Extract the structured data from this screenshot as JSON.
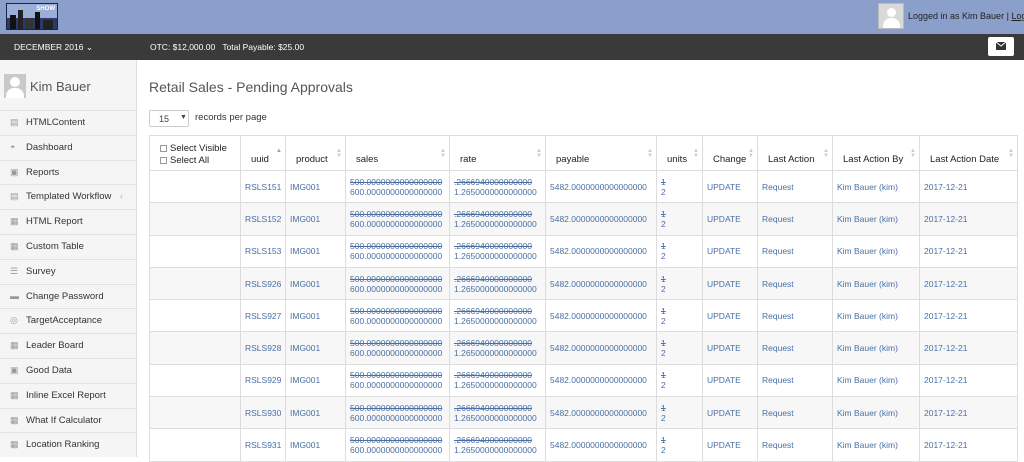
{
  "header": {
    "logo_text": "SHOW",
    "login_prefix": "Logged in as Kim Bauer",
    "separator": "|",
    "logout_label": "Logout"
  },
  "subbar": {
    "month_label": "DECEMBER 2016",
    "otc_label": "OTC: $12,000.00",
    "total_payable_label": "Total Payable: $25.00",
    "mail_icon": "envelope-icon"
  },
  "sidebar": {
    "user_name": "Kim Bauer",
    "items": [
      {
        "label": "HTMLContent",
        "icon": "file-icon"
      },
      {
        "label": "Dashboard",
        "icon": "dashboard-icon"
      },
      {
        "label": "Reports",
        "icon": "folder-icon"
      },
      {
        "label": "Templated Workflow",
        "icon": "file-icon",
        "chevron": "‹"
      },
      {
        "label": "HTML Report",
        "icon": "grid-icon"
      },
      {
        "label": "Custom Table",
        "icon": "grid-icon"
      },
      {
        "label": "Survey",
        "icon": "list-icon"
      },
      {
        "label": "Change Password",
        "icon": "lock-icon"
      },
      {
        "label": "TargetAcceptance",
        "icon": "target-icon"
      },
      {
        "label": "Leader Board",
        "icon": "grid-icon"
      },
      {
        "label": "Good Data",
        "icon": "folder-icon"
      },
      {
        "label": "Inline Excel Report",
        "icon": "grid-icon"
      },
      {
        "label": "What If Calculator",
        "icon": "grid-icon"
      },
      {
        "label": "Location Ranking",
        "icon": "grid-icon"
      }
    ]
  },
  "main": {
    "title": "Retail Sales - Pending Approvals",
    "page_size": "15",
    "records_per_page": "records per page",
    "select_visible": "Select Visible",
    "select_all": "Select All",
    "columns": [
      "uuid",
      "product",
      "sales",
      "rate",
      "payable",
      "units",
      "Change",
      "Last Action",
      "Last Action By",
      "Last Action Date"
    ],
    "rows": [
      {
        "uuid": "RSLS151",
        "product": "IMG001",
        "sales_old": "500.0000000000000000",
        "sales_new": "600.0000000000000000",
        "rate_old": ".2666940000000000",
        "rate_new": "1.2650000000000000",
        "payable": "5482.0000000000000000",
        "units_old": "1",
        "units_new": "2",
        "change": "UPDATE",
        "last_action": "Request",
        "last_action_by": "Kim Bauer (kim)",
        "last_action_date": "2017-12-21"
      },
      {
        "uuid": "RSLS152",
        "product": "IMG001",
        "sales_old": "500.0000000000000000",
        "sales_new": "600.0000000000000000",
        "rate_old": ".2666940000000000",
        "rate_new": "1.2650000000000000",
        "payable": "5482.0000000000000000",
        "units_old": "1",
        "units_new": "2",
        "change": "UPDATE",
        "last_action": "Request",
        "last_action_by": "Kim Bauer (kim)",
        "last_action_date": "2017-12-21"
      },
      {
        "uuid": "RSLS153",
        "product": "IMG001",
        "sales_old": "500.0000000000000000",
        "sales_new": "600.0000000000000000",
        "rate_old": ".2666940000000000",
        "rate_new": "1.2650000000000000",
        "payable": "5482.0000000000000000",
        "units_old": "1",
        "units_new": "2",
        "change": "UPDATE",
        "last_action": "Request",
        "last_action_by": "Kim Bauer (kim)",
        "last_action_date": "2017-12-21"
      },
      {
        "uuid": "RSLS926",
        "product": "IMG001",
        "sales_old": "500.0000000000000000",
        "sales_new": "600.0000000000000000",
        "rate_old": ".2666940000000000",
        "rate_new": "1.2650000000000000",
        "payable": "5482.0000000000000000",
        "units_old": "1",
        "units_new": "2",
        "change": "UPDATE",
        "last_action": "Request",
        "last_action_by": "Kim Bauer (kim)",
        "last_action_date": "2017-12-21"
      },
      {
        "uuid": "RSLS927",
        "product": "IMG001",
        "sales_old": "500.0000000000000000",
        "sales_new": "600.0000000000000000",
        "rate_old": ".2666940000000000",
        "rate_new": "1.2650000000000000",
        "payable": "5482.0000000000000000",
        "units_old": "1",
        "units_new": "2",
        "change": "UPDATE",
        "last_action": "Request",
        "last_action_by": "Kim Bauer (kim)",
        "last_action_date": "2017-12-21"
      },
      {
        "uuid": "RSLS928",
        "product": "IMG001",
        "sales_old": "500.0000000000000000",
        "sales_new": "600.0000000000000000",
        "rate_old": ".2666940000000000",
        "rate_new": "1.2650000000000000",
        "payable": "5482.0000000000000000",
        "units_old": "1",
        "units_new": "2",
        "change": "UPDATE",
        "last_action": "Request",
        "last_action_by": "Kim Bauer (kim)",
        "last_action_date": "2017-12-21"
      },
      {
        "uuid": "RSLS929",
        "product": "IMG001",
        "sales_old": "500.0000000000000000",
        "sales_new": "600.0000000000000000",
        "rate_old": ".2666940000000000",
        "rate_new": "1.2650000000000000",
        "payable": "5482.0000000000000000",
        "units_old": "1",
        "units_new": "2",
        "change": "UPDATE",
        "last_action": "Request",
        "last_action_by": "Kim Bauer (kim)",
        "last_action_date": "2017-12-21"
      },
      {
        "uuid": "RSLS930",
        "product": "IMG001",
        "sales_old": "500.0000000000000000",
        "sales_new": "600.0000000000000000",
        "rate_old": ".2666940000000000",
        "rate_new": "1.2650000000000000",
        "payable": "5482.0000000000000000",
        "units_old": "1",
        "units_new": "2",
        "change": "UPDATE",
        "last_action": "Request",
        "last_action_by": "Kim Bauer (kim)",
        "last_action_date": "2017-12-21"
      },
      {
        "uuid": "RSLS931",
        "product": "IMG001",
        "sales_old": "500.0000000000000000",
        "sales_new": "600.0000000000000000",
        "rate_old": ".2666940000000000",
        "rate_new": "1.2650000000000000",
        "payable": "5482.0000000000000000",
        "units_old": "1",
        "units_new": "2",
        "change": "UPDATE",
        "last_action": "Request",
        "last_action_by": "Kim Bauer (kim)",
        "last_action_date": "2017-12-21"
      }
    ]
  },
  "colors": {
    "topbar": "#8b9fcb",
    "subbar": "#3a3a3a",
    "link": "#4a6fa5"
  }
}
